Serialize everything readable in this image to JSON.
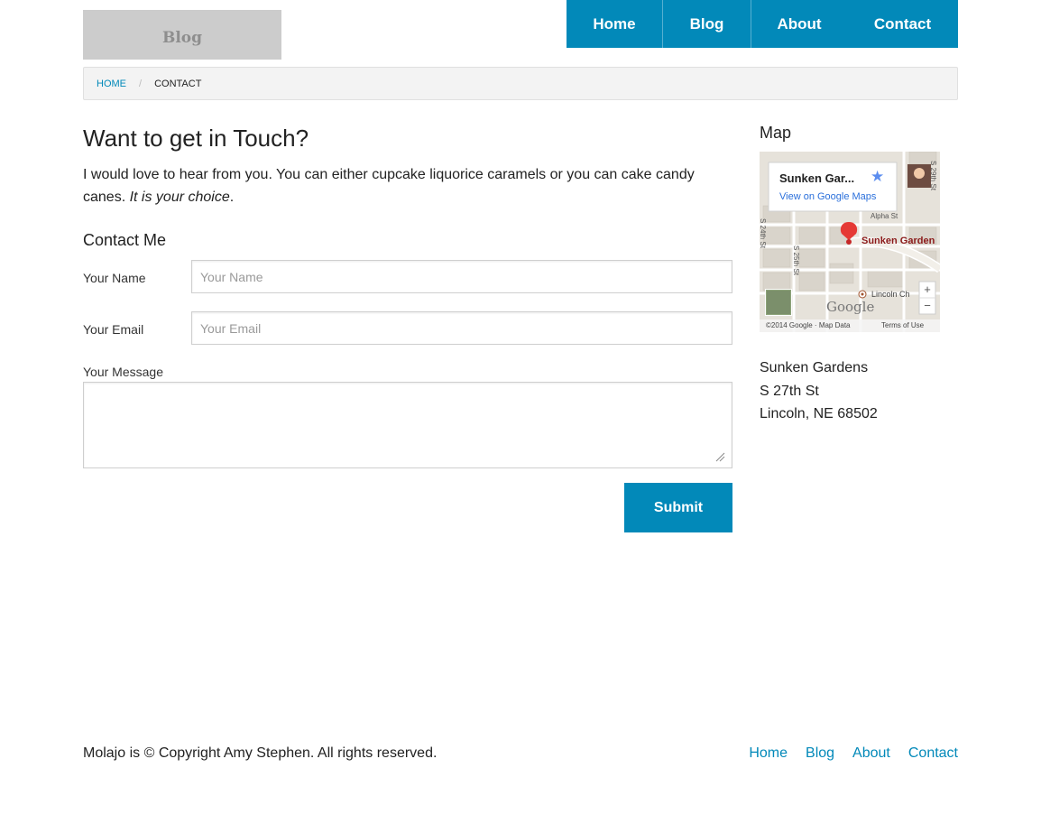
{
  "header": {
    "logo_text": "Blog",
    "nav": [
      {
        "label": "Home"
      },
      {
        "label": "Blog"
      },
      {
        "label": "About"
      },
      {
        "label": "Contact"
      }
    ]
  },
  "breadcrumb": {
    "home": "HOME",
    "separator": "/",
    "current": "CONTACT"
  },
  "main": {
    "title": "Want to get in Touch?",
    "intro_text": "I would love to hear from you. You can either cupcake liquorice caramels or you can cake candy canes. ",
    "intro_emphasis": "It is your choice",
    "intro_end": ".",
    "form_title": "Contact Me",
    "name_label": "Your Name",
    "name_placeholder": "Your Name",
    "email_label": "Your Email",
    "email_placeholder": "Your Email",
    "message_label": "Your Message",
    "submit_label": "Submit"
  },
  "sidebar": {
    "title": "Map",
    "map": {
      "place_title": "Sunken Gar...",
      "view_link": "View on Google Maps",
      "marker_label": "Sunken Garden",
      "streets": [
        "S 24th St",
        "S 25th St",
        "S 29th St",
        "Alpha St",
        "Lincoln Ch"
      ],
      "google_logo": "Google",
      "attribution": "©2014 Google · Map Data",
      "terms": "Terms of Use",
      "zoom_in": "+",
      "zoom_out": "−"
    },
    "address": {
      "line1": "Sunken Gardens",
      "line2": "S 27th St",
      "line3": "Lincoln, NE 68502"
    }
  },
  "footer": {
    "copyright": "Molajo is © Copyright Amy Stephen. All rights reserved.",
    "nav": [
      {
        "label": "Home"
      },
      {
        "label": "Blog"
      },
      {
        "label": "About"
      },
      {
        "label": "Contact"
      }
    ]
  },
  "colors": {
    "accent": "#0289b9",
    "logo_bg": "#cccccc",
    "breadcrumb_bg": "#f3f3f3"
  }
}
